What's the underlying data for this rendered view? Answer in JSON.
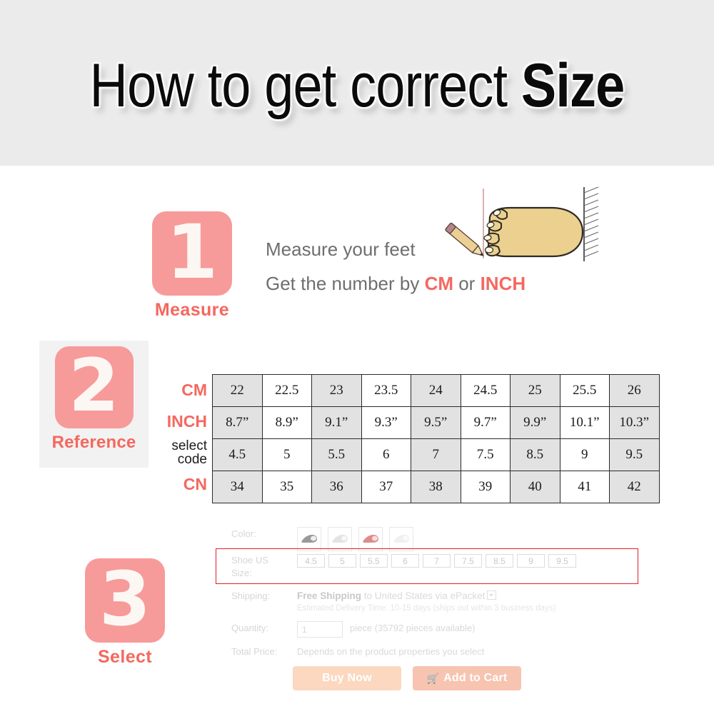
{
  "header": {
    "title_light": "How to get correct ",
    "title_bold": "Size"
  },
  "steps": [
    {
      "number": "1",
      "label": "Measure"
    },
    {
      "number": "2",
      "label": "Reference"
    },
    {
      "number": "3",
      "label": "Select"
    }
  ],
  "step1": {
    "line1": "Measure your feet",
    "line2_pre": "Get the number by ",
    "line2_cm": "CM",
    "line2_mid": " or ",
    "line2_inch": "INCH",
    "illustration": "foot-measure-illustration"
  },
  "size_chart": {
    "row_labels": {
      "cm": "CM",
      "inch": "INCH",
      "select_code_line1": "select",
      "select_code_line2": "code",
      "cn": "CN"
    },
    "rows": [
      {
        "key": "cm",
        "values": [
          "22",
          "22.5",
          "23",
          "23.5",
          "24",
          "24.5",
          "25",
          "25.5",
          "26"
        ]
      },
      {
        "key": "inch",
        "values": [
          "8.7”",
          "8.9”",
          "9.1”",
          "9.3”",
          "9.5”",
          "9.7”",
          "9.9”",
          "10.1”",
          "10.3”"
        ]
      },
      {
        "key": "select_code",
        "values": [
          "4.5",
          "5",
          "5.5",
          "6",
          "7",
          "7.5",
          "8.5",
          "9",
          "9.5"
        ]
      },
      {
        "key": "cn",
        "values": [
          "34",
          "35",
          "36",
          "37",
          "38",
          "39",
          "40",
          "41",
          "42"
        ]
      }
    ]
  },
  "product": {
    "color_label": "Color:",
    "swatches": [
      "shoe-swatch-gray",
      "shoe-swatch-white",
      "shoe-swatch-red",
      "shoe-swatch-pale"
    ],
    "size_label_line1": "Shoe US",
    "size_label_line2": "Size:",
    "size_options": [
      "4.5",
      "5",
      "5.5",
      "6",
      "7",
      "7.5",
      "8.5",
      "9",
      "9.5"
    ],
    "shipping_label": "Shipping:",
    "shipping_strong": "Free Shipping",
    "shipping_rest": " to United States via ePacket",
    "shipping_sub": "Estimated Delivery Time: 10-15 days (ships out within 3 business days)",
    "quantity_label": "Quantity:",
    "quantity_value": "1",
    "quantity_suffix": "piece (35792 pieces available)",
    "total_label": "Total Price:",
    "total_value": "Depends on the product properties you select",
    "buy_now": "Buy Now",
    "add_to_cart": "Add to Cart",
    "highlight_color": "#e0202a"
  },
  "colors": {
    "badge_pink": "#f79a9a",
    "label_red": "#f4685f",
    "header_bg": "#ebebeb",
    "table_alt": "#e2e2e2"
  }
}
